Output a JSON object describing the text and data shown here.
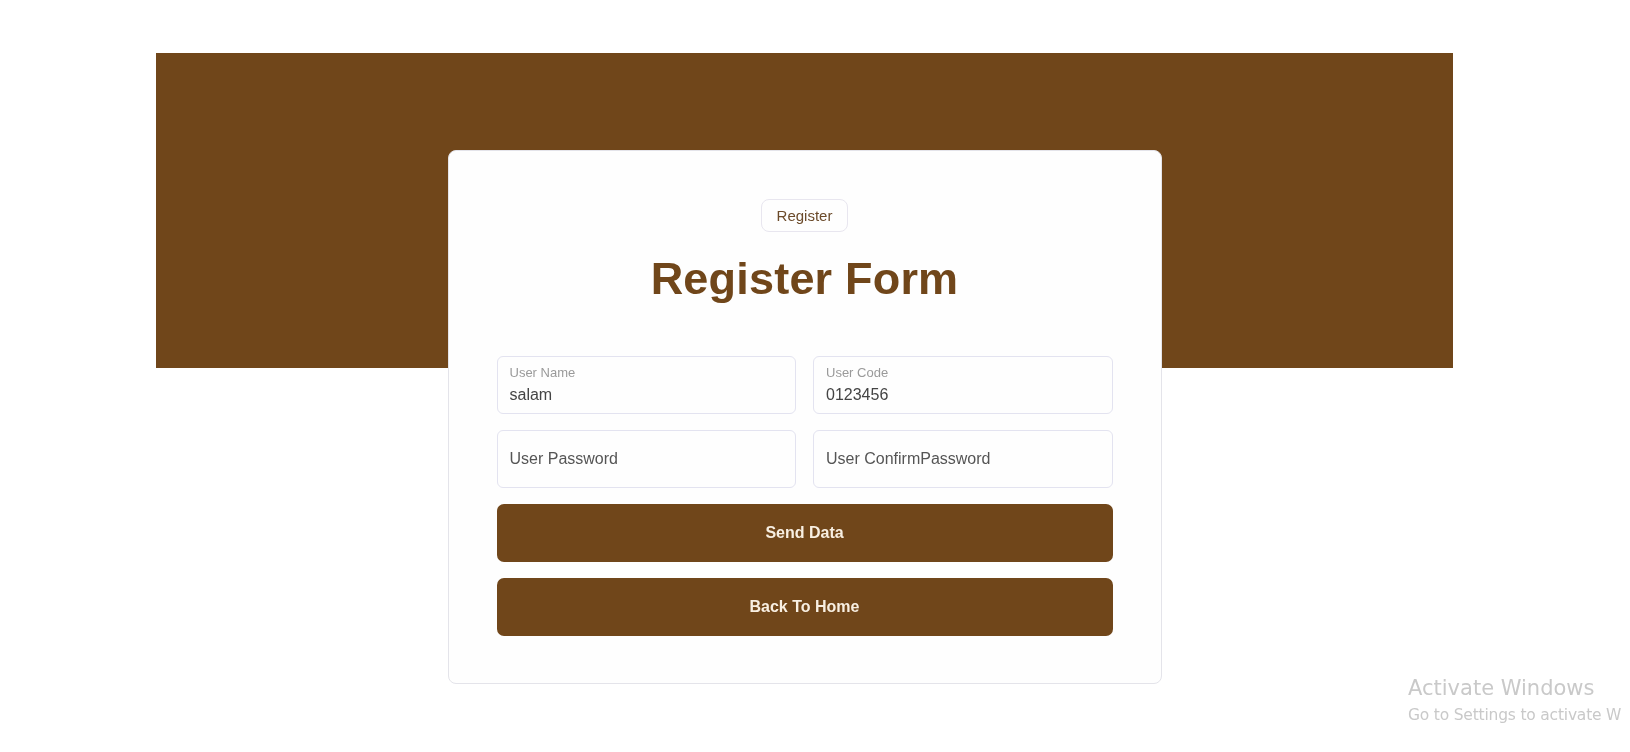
{
  "card": {
    "badge": "Register",
    "title": "Register Form",
    "fields": [
      {
        "label": "User Name",
        "value": "salam"
      },
      {
        "label": "User Code",
        "value": "0123456"
      },
      {
        "placeholder": "User Password"
      },
      {
        "placeholder": "User ConfirmPassword"
      }
    ],
    "buttons": [
      "Send Data",
      "Back To Home"
    ]
  },
  "os_notice": {
    "title": "Activate Windows",
    "text": "Go to Settings to activate W"
  }
}
